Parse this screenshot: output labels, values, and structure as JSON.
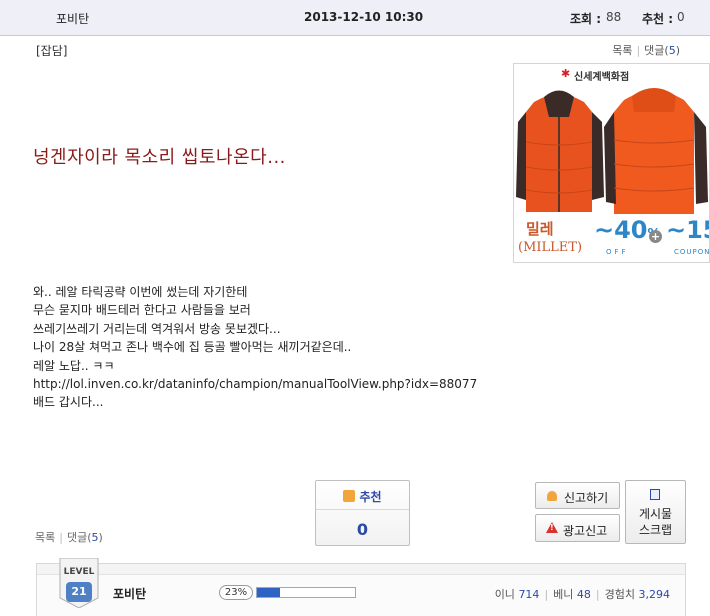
{
  "header": {
    "author": "포비탄",
    "date": "2013-12-10 10:30",
    "views_label": "조회 :",
    "views": "88",
    "recommend_label": "추천 :",
    "recommend": "0"
  },
  "category": "[잡담]",
  "links": {
    "list": "목록",
    "comments": "댓글(",
    "comment_count": "5",
    "comments_close": ")"
  },
  "ad": {
    "brand": "신세계백화점",
    "product_kr": "밀레",
    "product_en": "(MILLET)",
    "discount1": "~40",
    "percent": "%",
    "off": "OFF",
    "discount2": "~15",
    "coupon": "COUPON",
    "plus": "+"
  },
  "post": {
    "title": "넝겐자이라 목소리 씹토나온다...",
    "lines": [
      "와.. 레알 타릭공략 이번에 썼는데 자기한테",
      "무슨 묻지마 배드테러 한다고 사람들을 보러",
      "쓰레기쓰레기 거리는데 역겨워서 방송 못보겠다...",
      "나이 28살 쳐먹고 존나 백수에 집 등골 빨아먹는 새끼거같은데..",
      "레알 노답.. ㅋㅋ",
      "http://lol.inven.co.kr/dataninfo/champion/manualToolView.php?idx=88077",
      "배드 갑시다..."
    ]
  },
  "vote": {
    "label": "추천",
    "count": "0"
  },
  "buttons": {
    "report": "신고하기",
    "ad_report": "광고신고",
    "scrap_line1": "게시물",
    "scrap_line2": "스크랩"
  },
  "profile": {
    "level_label": "LEVEL",
    "level": "21",
    "name": "포비탄",
    "exp_percent_text": "23%",
    "exp_fraction": 0.23,
    "inni_label": "이니",
    "inni": "714",
    "benny_label": "베니",
    "benny": "48",
    "exp_label": "경험치",
    "exp": "3,294"
  }
}
